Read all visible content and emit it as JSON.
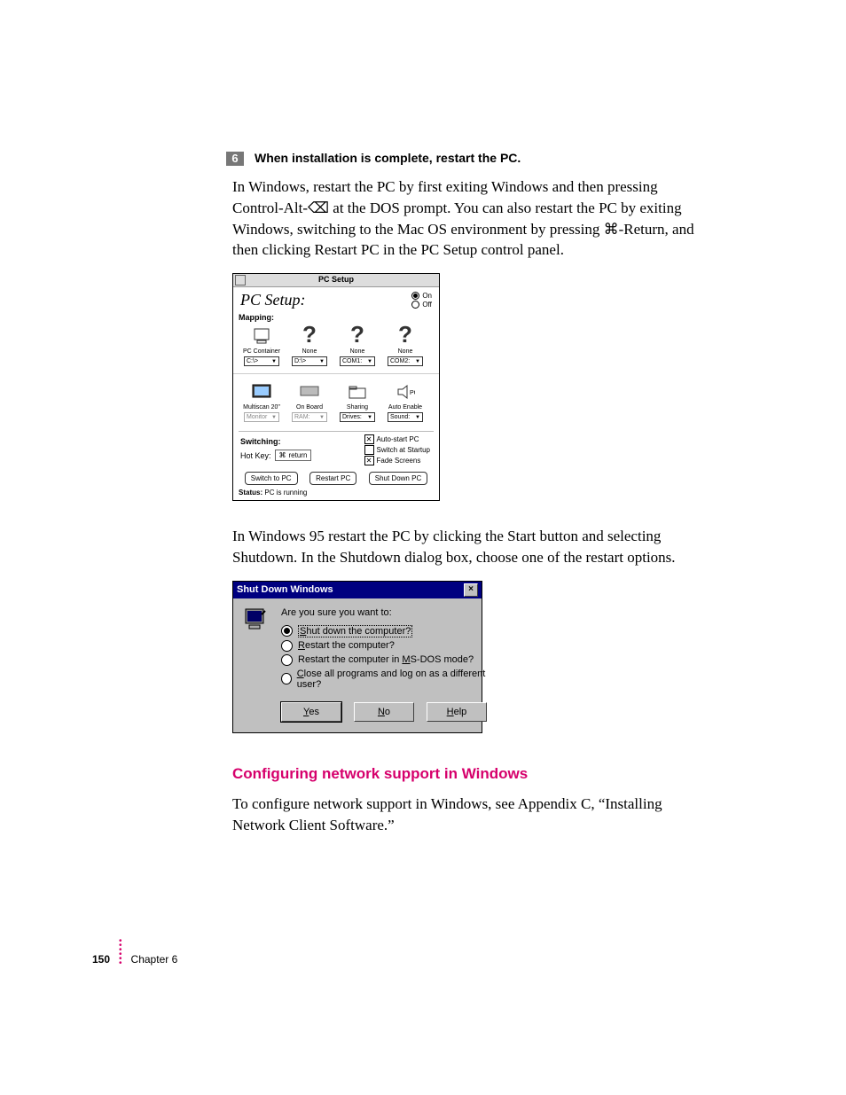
{
  "step": {
    "number": "6",
    "title": "When installation is complete, restart the PC."
  },
  "paragraph1": "In Windows, restart the PC by first exiting Windows and then pressing Control-Alt-⌫ at the DOS prompt. You can also restart the PC by exiting Windows, switching to the Mac OS environment by pressing ⌘-Return, and then clicking Restart PC in the PC Setup control panel.",
  "paragraph2": "In Windows 95 restart the PC by clicking the Start button and selecting Shutdown. In the Shutdown dialog box, choose one of the restart options.",
  "pc_setup": {
    "window_title": "PC Setup",
    "header_label": "PC Setup:",
    "on_label": "On",
    "off_label": "Off",
    "mapping_label": "Mapping:",
    "slots": {
      "container": {
        "caption": "PC Container",
        "dropdown": "C:\\>"
      },
      "d": {
        "caption": "None",
        "dropdown": "D:\\>"
      },
      "com": {
        "caption": "None",
        "dropdown": "COM1:"
      },
      "com2": {
        "caption": "None",
        "dropdown": "COM2:"
      }
    },
    "row2": {
      "multiscan": {
        "caption": "Multiscan 20\"",
        "dropdown": "Monitor"
      },
      "onboard": {
        "caption": "On Board",
        "dropdown": "RAM:"
      },
      "sharing": {
        "caption": "Sharing",
        "dropdown": "Drives:"
      },
      "sound": {
        "caption": "Auto Enable",
        "dropdown": "Sound:"
      }
    },
    "switching_label": "Switching:",
    "hotkey_label": "Hot Key:",
    "hotkey_value": "⌘ return",
    "check_autostart": "Auto-start PC",
    "check_switch_startup": "Switch at Startup",
    "check_fade": "Fade Screens",
    "btn_switch": "Switch to PC",
    "btn_restart": "Restart PC",
    "btn_shutdown": "Shut Down PC",
    "status_label": "Status:",
    "status_value": "PC is running"
  },
  "shutdown": {
    "title": "Shut Down Windows",
    "question": "Are you sure you want to:",
    "opt_shutdown": "Shut down the computer?",
    "opt_restart": "Restart the computer?",
    "opt_msdos": "Restart the computer in MS-DOS mode?",
    "opt_close": "Close all programs and log on as a different user?",
    "btn_yes": "Yes",
    "btn_no": "No",
    "btn_help": "Help"
  },
  "section_heading": "Configuring network support in Windows",
  "paragraph3": "To configure network support in Windows, see Appendix C, “Installing Network Client Software.”",
  "footer": {
    "page_number": "150",
    "chapter": "Chapter 6"
  }
}
